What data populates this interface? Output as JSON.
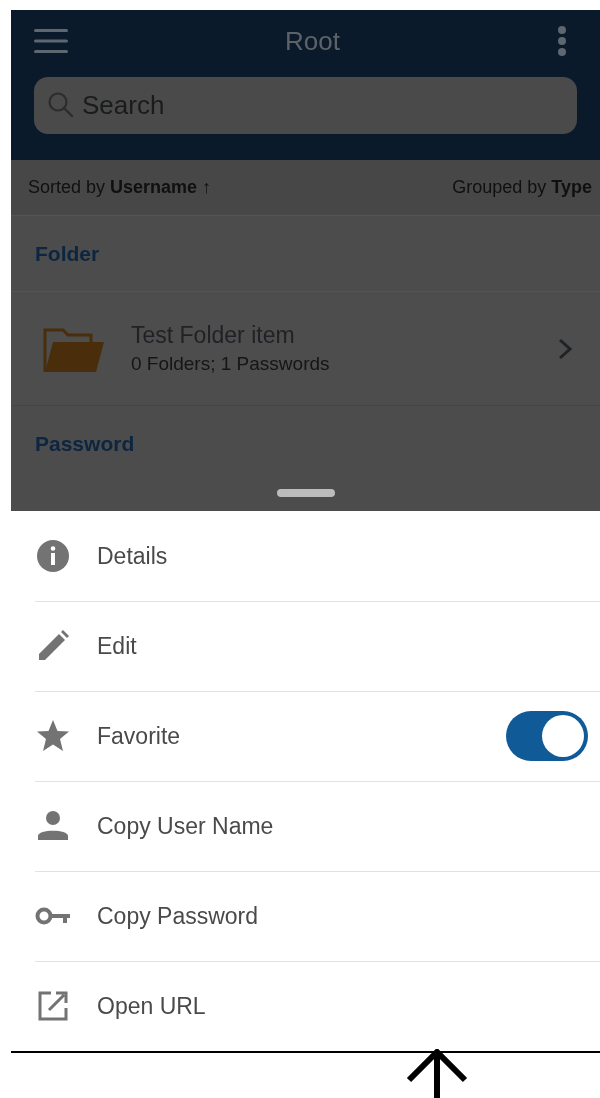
{
  "header": {
    "title": "Root",
    "search": {
      "placeholder": "Search"
    }
  },
  "sort_bar": {
    "sorted": "Sorted by **Username** ↑",
    "grouped": "Grouped by **Type**"
  },
  "groups": [
    {
      "title": "Folder",
      "items": [
        {
          "name": "Test Folder item",
          "subtitle": "0 Folders; 1 Passwords"
        }
      ]
    },
    {
      "title": "Password"
    }
  ],
  "action_sheet": {
    "actions": [
      {
        "kind": "plain",
        "label": "Details"
      },
      {
        "kind": "plain",
        "label": "Edit"
      },
      {
        "kind": "toggle",
        "label": "Favorite",
        "on": true
      },
      {
        "kind": "plain",
        "label": "Copy User Name"
      },
      {
        "kind": "plain",
        "label": "Copy Password"
      },
      {
        "kind": "plain",
        "label": "Open URL"
      }
    ]
  }
}
